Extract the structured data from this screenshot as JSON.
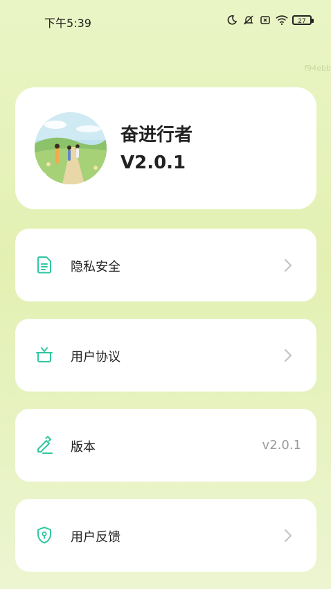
{
  "status_bar": {
    "time": "下午5:39",
    "battery": "27"
  },
  "watermark": "f94ebb",
  "profile": {
    "name": "奋进行者",
    "version": "V2.0.1"
  },
  "menu": [
    {
      "label": "隐私安全",
      "icon": "document-icon"
    },
    {
      "label": "用户协议",
      "icon": "gift-box-icon"
    },
    {
      "label": "版本",
      "icon": "pencil-icon",
      "value": "v2.0.1"
    },
    {
      "label": "用户反馈",
      "icon": "shield-icon"
    }
  ],
  "colors": {
    "accent": "#2fc7a0",
    "card": "#ffffff",
    "background": "#e6f2bc"
  }
}
